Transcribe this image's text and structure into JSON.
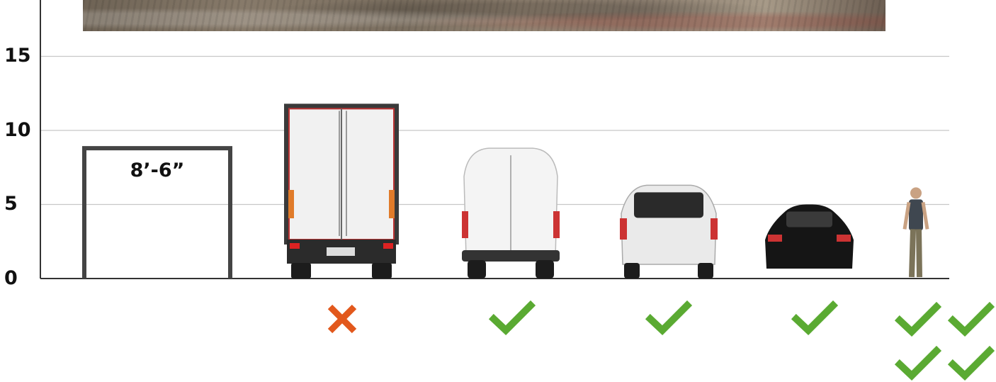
{
  "chart_data": {
    "type": "diagram",
    "y_axis": {
      "ticks": [
        "0",
        "5",
        "10",
        "15"
      ],
      "range": [
        0,
        18
      ],
      "grid": true
    },
    "clearance_box": {
      "label": "8’-6”",
      "height": 8.8
    },
    "vehicles": [
      {
        "icon": "box-truck-rear-icon",
        "height": 11.8,
        "status": "cross",
        "checks": 0
      },
      {
        "icon": "cargo-van-rear-icon",
        "height": 8.8,
        "status": "check",
        "checks": 1
      },
      {
        "icon": "minivan-rear-icon",
        "height": 6.3,
        "status": "check",
        "checks": 1
      },
      {
        "icon": "sedan-rear-icon",
        "height": 5.0,
        "status": "check",
        "checks": 1
      },
      {
        "icon": "pedestrian-icon",
        "height": 6.2,
        "status": "check",
        "checks": 4
      }
    ],
    "colors": {
      "check": "#5aaa32",
      "cross": "#e2581c",
      "axis": "#333333",
      "grid": "#c8c8c8",
      "box": "#444444"
    }
  }
}
